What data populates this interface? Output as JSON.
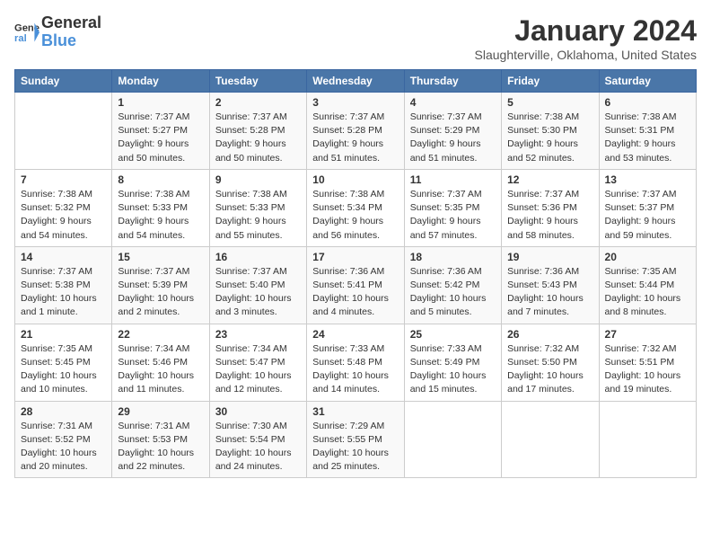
{
  "logo": {
    "line1": "General",
    "line2": "Blue"
  },
  "title": "January 2024",
  "location": "Slaughterville, Oklahoma, United States",
  "weekdays": [
    "Sunday",
    "Monday",
    "Tuesday",
    "Wednesday",
    "Thursday",
    "Friday",
    "Saturday"
  ],
  "weeks": [
    [
      {
        "day": "",
        "sunrise": "",
        "sunset": "",
        "daylight": ""
      },
      {
        "day": "1",
        "sunrise": "Sunrise: 7:37 AM",
        "sunset": "Sunset: 5:27 PM",
        "daylight": "Daylight: 9 hours and 50 minutes."
      },
      {
        "day": "2",
        "sunrise": "Sunrise: 7:37 AM",
        "sunset": "Sunset: 5:28 PM",
        "daylight": "Daylight: 9 hours and 50 minutes."
      },
      {
        "day": "3",
        "sunrise": "Sunrise: 7:37 AM",
        "sunset": "Sunset: 5:28 PM",
        "daylight": "Daylight: 9 hours and 51 minutes."
      },
      {
        "day": "4",
        "sunrise": "Sunrise: 7:37 AM",
        "sunset": "Sunset: 5:29 PM",
        "daylight": "Daylight: 9 hours and 51 minutes."
      },
      {
        "day": "5",
        "sunrise": "Sunrise: 7:38 AM",
        "sunset": "Sunset: 5:30 PM",
        "daylight": "Daylight: 9 hours and 52 minutes."
      },
      {
        "day": "6",
        "sunrise": "Sunrise: 7:38 AM",
        "sunset": "Sunset: 5:31 PM",
        "daylight": "Daylight: 9 hours and 53 minutes."
      }
    ],
    [
      {
        "day": "7",
        "sunrise": "Sunrise: 7:38 AM",
        "sunset": "Sunset: 5:32 PM",
        "daylight": "Daylight: 9 hours and 54 minutes."
      },
      {
        "day": "8",
        "sunrise": "Sunrise: 7:38 AM",
        "sunset": "Sunset: 5:33 PM",
        "daylight": "Daylight: 9 hours and 54 minutes."
      },
      {
        "day": "9",
        "sunrise": "Sunrise: 7:38 AM",
        "sunset": "Sunset: 5:33 PM",
        "daylight": "Daylight: 9 hours and 55 minutes."
      },
      {
        "day": "10",
        "sunrise": "Sunrise: 7:38 AM",
        "sunset": "Sunset: 5:34 PM",
        "daylight": "Daylight: 9 hours and 56 minutes."
      },
      {
        "day": "11",
        "sunrise": "Sunrise: 7:37 AM",
        "sunset": "Sunset: 5:35 PM",
        "daylight": "Daylight: 9 hours and 57 minutes."
      },
      {
        "day": "12",
        "sunrise": "Sunrise: 7:37 AM",
        "sunset": "Sunset: 5:36 PM",
        "daylight": "Daylight: 9 hours and 58 minutes."
      },
      {
        "day": "13",
        "sunrise": "Sunrise: 7:37 AM",
        "sunset": "Sunset: 5:37 PM",
        "daylight": "Daylight: 9 hours and 59 minutes."
      }
    ],
    [
      {
        "day": "14",
        "sunrise": "Sunrise: 7:37 AM",
        "sunset": "Sunset: 5:38 PM",
        "daylight": "Daylight: 10 hours and 1 minute."
      },
      {
        "day": "15",
        "sunrise": "Sunrise: 7:37 AM",
        "sunset": "Sunset: 5:39 PM",
        "daylight": "Daylight: 10 hours and 2 minutes."
      },
      {
        "day": "16",
        "sunrise": "Sunrise: 7:37 AM",
        "sunset": "Sunset: 5:40 PM",
        "daylight": "Daylight: 10 hours and 3 minutes."
      },
      {
        "day": "17",
        "sunrise": "Sunrise: 7:36 AM",
        "sunset": "Sunset: 5:41 PM",
        "daylight": "Daylight: 10 hours and 4 minutes."
      },
      {
        "day": "18",
        "sunrise": "Sunrise: 7:36 AM",
        "sunset": "Sunset: 5:42 PM",
        "daylight": "Daylight: 10 hours and 5 minutes."
      },
      {
        "day": "19",
        "sunrise": "Sunrise: 7:36 AM",
        "sunset": "Sunset: 5:43 PM",
        "daylight": "Daylight: 10 hours and 7 minutes."
      },
      {
        "day": "20",
        "sunrise": "Sunrise: 7:35 AM",
        "sunset": "Sunset: 5:44 PM",
        "daylight": "Daylight: 10 hours and 8 minutes."
      }
    ],
    [
      {
        "day": "21",
        "sunrise": "Sunrise: 7:35 AM",
        "sunset": "Sunset: 5:45 PM",
        "daylight": "Daylight: 10 hours and 10 minutes."
      },
      {
        "day": "22",
        "sunrise": "Sunrise: 7:34 AM",
        "sunset": "Sunset: 5:46 PM",
        "daylight": "Daylight: 10 hours and 11 minutes."
      },
      {
        "day": "23",
        "sunrise": "Sunrise: 7:34 AM",
        "sunset": "Sunset: 5:47 PM",
        "daylight": "Daylight: 10 hours and 12 minutes."
      },
      {
        "day": "24",
        "sunrise": "Sunrise: 7:33 AM",
        "sunset": "Sunset: 5:48 PM",
        "daylight": "Daylight: 10 hours and 14 minutes."
      },
      {
        "day": "25",
        "sunrise": "Sunrise: 7:33 AM",
        "sunset": "Sunset: 5:49 PM",
        "daylight": "Daylight: 10 hours and 15 minutes."
      },
      {
        "day": "26",
        "sunrise": "Sunrise: 7:32 AM",
        "sunset": "Sunset: 5:50 PM",
        "daylight": "Daylight: 10 hours and 17 minutes."
      },
      {
        "day": "27",
        "sunrise": "Sunrise: 7:32 AM",
        "sunset": "Sunset: 5:51 PM",
        "daylight": "Daylight: 10 hours and 19 minutes."
      }
    ],
    [
      {
        "day": "28",
        "sunrise": "Sunrise: 7:31 AM",
        "sunset": "Sunset: 5:52 PM",
        "daylight": "Daylight: 10 hours and 20 minutes."
      },
      {
        "day": "29",
        "sunrise": "Sunrise: 7:31 AM",
        "sunset": "Sunset: 5:53 PM",
        "daylight": "Daylight: 10 hours and 22 minutes."
      },
      {
        "day": "30",
        "sunrise": "Sunrise: 7:30 AM",
        "sunset": "Sunset: 5:54 PM",
        "daylight": "Daylight: 10 hours and 24 minutes."
      },
      {
        "day": "31",
        "sunrise": "Sunrise: 7:29 AM",
        "sunset": "Sunset: 5:55 PM",
        "daylight": "Daylight: 10 hours and 25 minutes."
      },
      {
        "day": "",
        "sunrise": "",
        "sunset": "",
        "daylight": ""
      },
      {
        "day": "",
        "sunrise": "",
        "sunset": "",
        "daylight": ""
      },
      {
        "day": "",
        "sunrise": "",
        "sunset": "",
        "daylight": ""
      }
    ]
  ]
}
